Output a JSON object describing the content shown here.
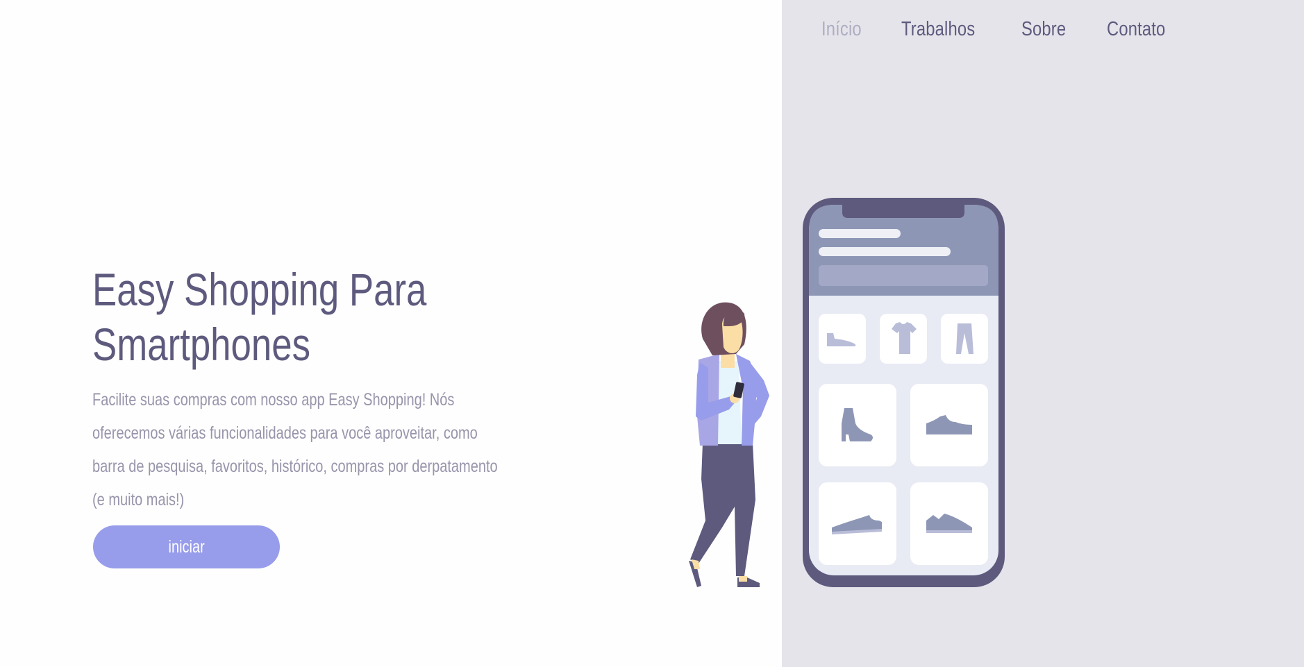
{
  "nav": {
    "items": [
      {
        "label": "Início",
        "active": true
      },
      {
        "label": "Trabalhos",
        "active": false
      },
      {
        "label": "Sobre",
        "active": false
      },
      {
        "label": "Contato",
        "active": false
      }
    ]
  },
  "hero": {
    "title_line1": "Easy Shopping Para",
    "title_line2": "Smartphones",
    "description": "Facilite suas compras com nosso app Easy Shopping! Nós oferecemos várias funcionalidades para você aproveitar, como barra de pesquisa, favoritos, histórico, compras por derpatamento (e muito mais!)",
    "button_label": "iniciar"
  },
  "illustration": {
    "phone_categories": [
      "low-shoe-icon",
      "tshirt-icon",
      "pants-icon"
    ],
    "phone_products": [
      "boot-icon",
      "sneaker-icon",
      "sneaker-icon",
      "sneaker-icon"
    ]
  },
  "colors": {
    "accent": "#979ceb",
    "heading": "#5d5a7e",
    "muted_text": "#9795ab",
    "panel_bg": "#e5e4ea",
    "nav_active": "#aeaec2"
  }
}
